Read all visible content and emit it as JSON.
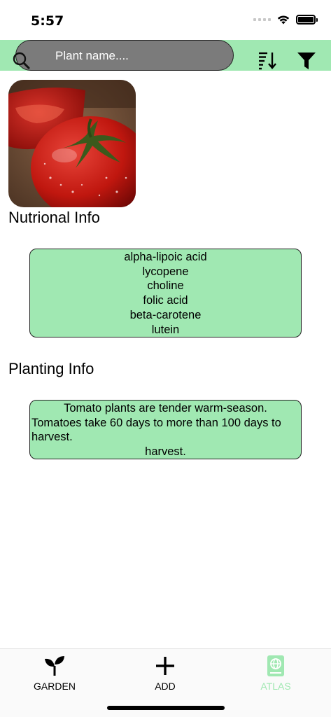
{
  "status_bar": {
    "time": "5:57"
  },
  "search": {
    "placeholder": "Plant name....",
    "value": ""
  },
  "toolbar": {
    "sort_icon": "sort-descending-icon",
    "filter_icon": "filter-icon"
  },
  "plant": {
    "image_alt": "tomato"
  },
  "nutritional": {
    "title": "Nutrional Info",
    "items": [
      "alpha-lipoic acid",
      "lycopene",
      "choline",
      "folic acid",
      "beta-carotene",
      "lutein"
    ]
  },
  "planting": {
    "title": "Planting Info",
    "lines": [
      "Tomato plants are tender warm-season.",
      "Tomatoes take 60 days to more than 100 days to",
      "harvest.",
      "harvest."
    ]
  },
  "tabs": [
    {
      "label": "GARDEN",
      "icon": "sprout-icon",
      "active": false
    },
    {
      "label": "ADD",
      "icon": "plus-icon",
      "active": false
    },
    {
      "label": "ATLAS",
      "icon": "atlas-book-icon",
      "active": true
    }
  ],
  "colors": {
    "accent_green": "#a0e8b2",
    "search_gray": "#7b7b7b",
    "active_tab": "#a0e8b2"
  }
}
